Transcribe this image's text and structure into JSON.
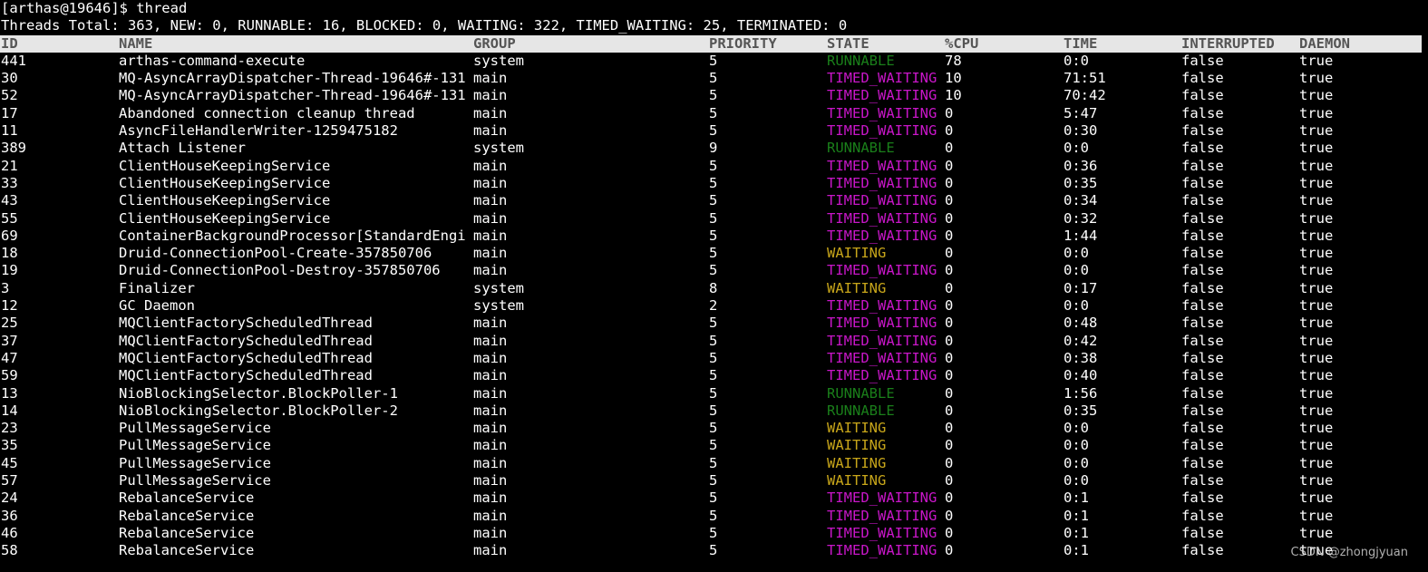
{
  "prompt": "[arthas@19646]$ thread",
  "summary": "Threads Total: 363, NEW: 0, RUNNABLE: 16, BLOCKED: 0, WAITING: 322, TIMED_WAITING: 25, TERMINATED: 0",
  "columns": [
    "ID",
    "NAME",
    "GROUP",
    "PRIORITY",
    "STATE",
    "%CPU",
    "TIME",
    "INTERRUPTED",
    "DAEMON"
  ],
  "state_colors": {
    "RUNNABLE": "#1a7f1a",
    "TIMED_WAITING": "#c916c9",
    "WAITING": "#c8a61a"
  },
  "rows": [
    {
      "id": "441",
      "name": "arthas-command-execute",
      "group": "system",
      "priority": "5",
      "state": "RUNNABLE",
      "cpu": "78",
      "time": "0:0",
      "interrupted": "false",
      "daemon": "true"
    },
    {
      "id": "30",
      "name": "MQ-AsyncArrayDispatcher-Thread-19646#-131",
      "group": "main",
      "priority": "5",
      "state": "TIMED_WAITING",
      "cpu": "10",
      "time": "71:51",
      "interrupted": "false",
      "daemon": "true"
    },
    {
      "id": "52",
      "name": "MQ-AsyncArrayDispatcher-Thread-19646#-131",
      "group": "main",
      "priority": "5",
      "state": "TIMED_WAITING",
      "cpu": "10",
      "time": "70:42",
      "interrupted": "false",
      "daemon": "true"
    },
    {
      "id": "17",
      "name": "Abandoned connection cleanup thread",
      "group": "main",
      "priority": "5",
      "state": "TIMED_WAITING",
      "cpu": "0",
      "time": "5:47",
      "interrupted": "false",
      "daemon": "true"
    },
    {
      "id": "11",
      "name": "AsyncFileHandlerWriter-1259475182",
      "group": "main",
      "priority": "5",
      "state": "TIMED_WAITING",
      "cpu": "0",
      "time": "0:30",
      "interrupted": "false",
      "daemon": "true"
    },
    {
      "id": "389",
      "name": "Attach Listener",
      "group": "system",
      "priority": "9",
      "state": "RUNNABLE",
      "cpu": "0",
      "time": "0:0",
      "interrupted": "false",
      "daemon": "true"
    },
    {
      "id": "21",
      "name": "ClientHouseKeepingService",
      "group": "main",
      "priority": "5",
      "state": "TIMED_WAITING",
      "cpu": "0",
      "time": "0:36",
      "interrupted": "false",
      "daemon": "true"
    },
    {
      "id": "33",
      "name": "ClientHouseKeepingService",
      "group": "main",
      "priority": "5",
      "state": "TIMED_WAITING",
      "cpu": "0",
      "time": "0:35",
      "interrupted": "false",
      "daemon": "true"
    },
    {
      "id": "43",
      "name": "ClientHouseKeepingService",
      "group": "main",
      "priority": "5",
      "state": "TIMED_WAITING",
      "cpu": "0",
      "time": "0:34",
      "interrupted": "false",
      "daemon": "true"
    },
    {
      "id": "55",
      "name": "ClientHouseKeepingService",
      "group": "main",
      "priority": "5",
      "state": "TIMED_WAITING",
      "cpu": "0",
      "time": "0:32",
      "interrupted": "false",
      "daemon": "true"
    },
    {
      "id": "69",
      "name": "ContainerBackgroundProcessor[StandardEngi",
      "group": "main",
      "priority": "5",
      "state": "TIMED_WAITING",
      "cpu": "0",
      "time": "1:44",
      "interrupted": "false",
      "daemon": "true"
    },
    {
      "id": "18",
      "name": "Druid-ConnectionPool-Create-357850706",
      "group": "main",
      "priority": "5",
      "state": "WAITING",
      "cpu": "0",
      "time": "0:0",
      "interrupted": "false",
      "daemon": "true"
    },
    {
      "id": "19",
      "name": "Druid-ConnectionPool-Destroy-357850706",
      "group": "main",
      "priority": "5",
      "state": "TIMED_WAITING",
      "cpu": "0",
      "time": "0:0",
      "interrupted": "false",
      "daemon": "true"
    },
    {
      "id": "3",
      "name": "Finalizer",
      "group": "system",
      "priority": "8",
      "state": "WAITING",
      "cpu": "0",
      "time": "0:17",
      "interrupted": "false",
      "daemon": "true"
    },
    {
      "id": "12",
      "name": "GC Daemon",
      "group": "system",
      "priority": "2",
      "state": "TIMED_WAITING",
      "cpu": "0",
      "time": "0:0",
      "interrupted": "false",
      "daemon": "true"
    },
    {
      "id": "25",
      "name": "MQClientFactoryScheduledThread",
      "group": "main",
      "priority": "5",
      "state": "TIMED_WAITING",
      "cpu": "0",
      "time": "0:48",
      "interrupted": "false",
      "daemon": "true"
    },
    {
      "id": "37",
      "name": "MQClientFactoryScheduledThread",
      "group": "main",
      "priority": "5",
      "state": "TIMED_WAITING",
      "cpu": "0",
      "time": "0:42",
      "interrupted": "false",
      "daemon": "true"
    },
    {
      "id": "47",
      "name": "MQClientFactoryScheduledThread",
      "group": "main",
      "priority": "5",
      "state": "TIMED_WAITING",
      "cpu": "0",
      "time": "0:38",
      "interrupted": "false",
      "daemon": "true"
    },
    {
      "id": "59",
      "name": "MQClientFactoryScheduledThread",
      "group": "main",
      "priority": "5",
      "state": "TIMED_WAITING",
      "cpu": "0",
      "time": "0:40",
      "interrupted": "false",
      "daemon": "true"
    },
    {
      "id": "13",
      "name": "NioBlockingSelector.BlockPoller-1",
      "group": "main",
      "priority": "5",
      "state": "RUNNABLE",
      "cpu": "0",
      "time": "1:56",
      "interrupted": "false",
      "daemon": "true"
    },
    {
      "id": "14",
      "name": "NioBlockingSelector.BlockPoller-2",
      "group": "main",
      "priority": "5",
      "state": "RUNNABLE",
      "cpu": "0",
      "time": "0:35",
      "interrupted": "false",
      "daemon": "true"
    },
    {
      "id": "23",
      "name": "PullMessageService",
      "group": "main",
      "priority": "5",
      "state": "WAITING",
      "cpu": "0",
      "time": "0:0",
      "interrupted": "false",
      "daemon": "true"
    },
    {
      "id": "35",
      "name": "PullMessageService",
      "group": "main",
      "priority": "5",
      "state": "WAITING",
      "cpu": "0",
      "time": "0:0",
      "interrupted": "false",
      "daemon": "true"
    },
    {
      "id": "45",
      "name": "PullMessageService",
      "group": "main",
      "priority": "5",
      "state": "WAITING",
      "cpu": "0",
      "time": "0:0",
      "interrupted": "false",
      "daemon": "true"
    },
    {
      "id": "57",
      "name": "PullMessageService",
      "group": "main",
      "priority": "5",
      "state": "WAITING",
      "cpu": "0",
      "time": "0:0",
      "interrupted": "false",
      "daemon": "true"
    },
    {
      "id": "24",
      "name": "RebalanceService",
      "group": "main",
      "priority": "5",
      "state": "TIMED_WAITING",
      "cpu": "0",
      "time": "0:1",
      "interrupted": "false",
      "daemon": "true"
    },
    {
      "id": "36",
      "name": "RebalanceService",
      "group": "main",
      "priority": "5",
      "state": "TIMED_WAITING",
      "cpu": "0",
      "time": "0:1",
      "interrupted": "false",
      "daemon": "true"
    },
    {
      "id": "46",
      "name": "RebalanceService",
      "group": "main",
      "priority": "5",
      "state": "TIMED_WAITING",
      "cpu": "0",
      "time": "0:1",
      "interrupted": "false",
      "daemon": "true"
    },
    {
      "id": "58",
      "name": "RebalanceService",
      "group": "main",
      "priority": "5",
      "state": "TIMED_WAITING",
      "cpu": "0",
      "time": "0:1",
      "interrupted": "false",
      "daemon": "true"
    }
  ],
  "watermark": "CSDN @zhongjyuan"
}
